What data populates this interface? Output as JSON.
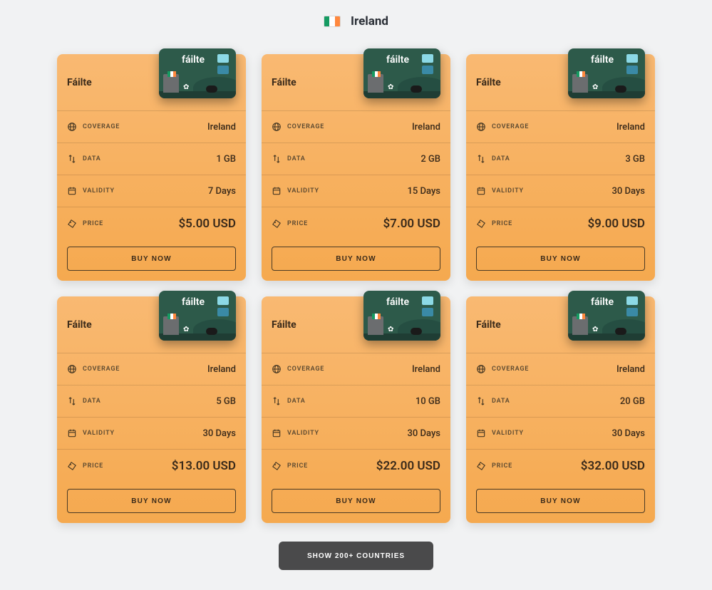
{
  "header": {
    "country": "Ireland",
    "flag_colors": {
      "left": "#169b62",
      "mid": "#ffffff",
      "right": "#ff883e"
    }
  },
  "labels": {
    "coverage": "COVERAGE",
    "data": "DATA",
    "validity": "VALIDITY",
    "price": "PRICE",
    "buy": "BUY NOW"
  },
  "esim_brand": "fáilte",
  "plans": [
    {
      "name": "Fáilte",
      "coverage": "Ireland",
      "data": "1 GB",
      "validity": "7 Days",
      "price": "$5.00 USD"
    },
    {
      "name": "Fáilte",
      "coverage": "Ireland",
      "data": "2 GB",
      "validity": "15 Days",
      "price": "$7.00 USD"
    },
    {
      "name": "Fáilte",
      "coverage": "Ireland",
      "data": "3 GB",
      "validity": "30 Days",
      "price": "$9.00 USD"
    },
    {
      "name": "Fáilte",
      "coverage": "Ireland",
      "data": "5 GB",
      "validity": "30 Days",
      "price": "$13.00 USD"
    },
    {
      "name": "Fáilte",
      "coverage": "Ireland",
      "data": "10 GB",
      "validity": "30 Days",
      "price": "$22.00 USD"
    },
    {
      "name": "Fáilte",
      "coverage": "Ireland",
      "data": "20 GB",
      "validity": "30 Days",
      "price": "$32.00 USD"
    }
  ],
  "footer": {
    "show_countries": "SHOW 200+ COUNTRIES"
  }
}
